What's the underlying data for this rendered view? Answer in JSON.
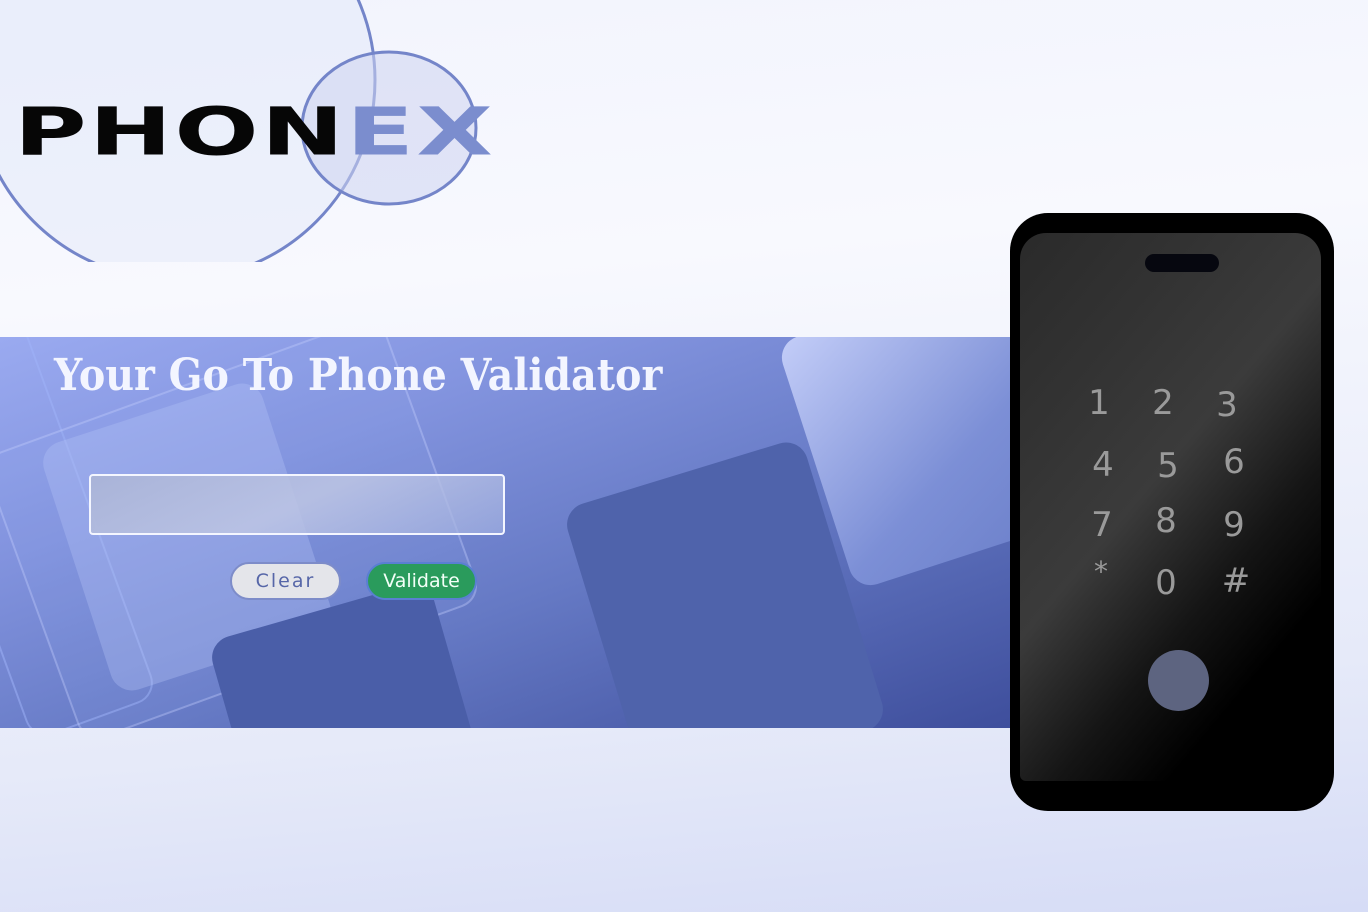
{
  "logo": {
    "text_dark": "PHON",
    "text_accent": "EX"
  },
  "banner": {
    "headline": "Your Go To Phone Validator"
  },
  "form": {
    "phone_value": "",
    "placeholder": "",
    "clear_label": "Clear",
    "validate_label": "Validate"
  },
  "keypad": {
    "keys": [
      "1",
      "2",
      "3",
      "4",
      "5",
      "6",
      "7",
      "8",
      "9",
      "*",
      "0",
      "#"
    ]
  },
  "colors": {
    "accent": "#7b8dce",
    "validate_button": "#2a9b5c",
    "banner": "#7284d4"
  }
}
